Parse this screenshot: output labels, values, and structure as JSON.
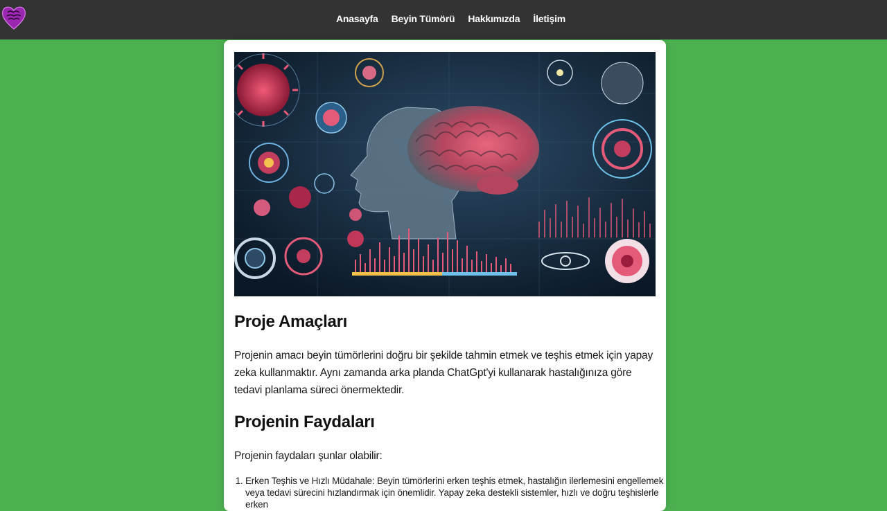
{
  "nav": {
    "links": [
      "Anasayfa",
      "Beyin Tümörü",
      "Hakkımızda",
      "İletişim"
    ]
  },
  "hero": {
    "icon": "brain-tumor-illustration"
  },
  "section1": {
    "title": "Proje Amaçları",
    "text": "Projenin amacı beyin tümörlerini doğru bir şekilde tahmin etmek ve teşhis etmek için yapay zeka kullanmaktır. Aynı zamanda arka planda ChatGpt'yi kullanarak hastalığınıza göre tedavi planlama süreci önermektedir."
  },
  "section2": {
    "title": "Projenin Faydaları",
    "intro": "Projenin faydaları şunlar olabilir:",
    "items": [
      "Erken Teşhis ve Hızlı Müdahale: Beyin tümörlerini erken teşhis etmek, hastalığın ilerlemesini engellemek veya tedavi sürecini hızlandırmak için önemlidir. Yapay zeka destekli sistemler, hızlı ve doğru teşhislerle erken"
    ]
  },
  "colors": {
    "navbar": "#333333",
    "background": "#4caf50",
    "card": "#ffffff",
    "logo": "#9b27b0"
  }
}
